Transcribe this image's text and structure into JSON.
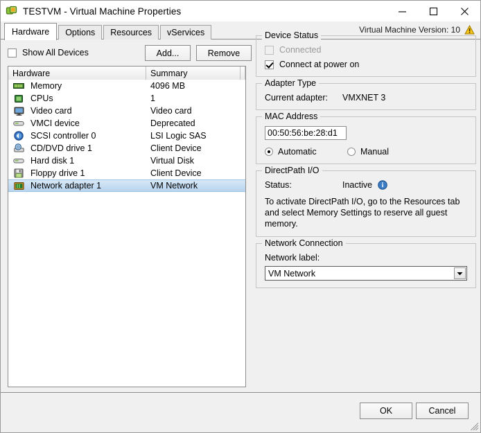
{
  "window": {
    "title": "TESTVM - Virtual Machine Properties",
    "app_icon": "vmware-vm-icon",
    "minimize_label": "Minimize",
    "maximize_label": "Maximize",
    "close_label": "Close"
  },
  "tabs": [
    {
      "label": "Hardware",
      "active": true
    },
    {
      "label": "Options",
      "active": false
    },
    {
      "label": "Resources",
      "active": false
    },
    {
      "label": "vServices",
      "active": false
    }
  ],
  "vm_version": {
    "text": "Virtual Machine Version:  10",
    "icon": "warning-triangle-icon"
  },
  "left_pane": {
    "show_all_devices": {
      "label": "Show All Devices",
      "checked": false
    },
    "add_button": "Add...",
    "remove_button": "Remove",
    "columns": [
      "Hardware",
      "Summary"
    ],
    "rows": [
      {
        "icon": "memory-icon",
        "name": "Memory",
        "summary": "4096 MB",
        "selected": false
      },
      {
        "icon": "cpu-icon",
        "name": "CPUs",
        "summary": "1",
        "selected": false
      },
      {
        "icon": "video-card-icon",
        "name": "Video card",
        "summary": "Video card",
        "selected": false
      },
      {
        "icon": "vmci-device-icon",
        "name": "VMCI device",
        "summary": "Deprecated",
        "selected": false
      },
      {
        "icon": "scsi-controller-icon",
        "name": "SCSI controller 0",
        "summary": "LSI Logic SAS",
        "selected": false
      },
      {
        "icon": "cd-dvd-drive-icon",
        "name": "CD/DVD drive 1",
        "summary": "Client Device",
        "selected": false
      },
      {
        "icon": "hard-disk-icon",
        "name": "Hard disk 1",
        "summary": "Virtual Disk",
        "selected": false
      },
      {
        "icon": "floppy-drive-icon",
        "name": "Floppy drive 1",
        "summary": "Client Device",
        "selected": false
      },
      {
        "icon": "network-adapter-icon",
        "name": "Network adapter 1",
        "summary": "VM Network",
        "selected": true
      }
    ]
  },
  "right_pane": {
    "device_status": {
      "legend": "Device Status",
      "connected": {
        "label": "Connected",
        "checked": false,
        "disabled": true
      },
      "connect_at_power_on": {
        "label": "Connect at power on",
        "checked": true,
        "disabled": false
      }
    },
    "adapter_type": {
      "legend": "Adapter Type",
      "current_adapter_label": "Current adapter:",
      "current_adapter_value": "VMXNET 3"
    },
    "mac_address": {
      "legend": "MAC Address",
      "value": "00:50:56:be:28:d1",
      "automatic_label": "Automatic",
      "manual_label": "Manual",
      "selected_mode": "Automatic"
    },
    "directpath": {
      "legend": "DirectPath I/O",
      "status_label": "Status:",
      "status_value": "Inactive",
      "info_icon": "info-icon",
      "note": "To activate DirectPath I/O, go to the Resources tab and select Memory Settings to reserve all guest memory."
    },
    "network_connection": {
      "legend": "Network Connection",
      "network_label_caption": "Network label:",
      "selected_network": "VM Network"
    }
  },
  "footer": {
    "ok_label": "OK",
    "cancel_label": "Cancel"
  },
  "colors": {
    "selection_top": "#d6e8f7",
    "selection_bottom": "#b9d4ee",
    "dialog_bg": "#f0f0f0",
    "info_blue": "#3b7cc4",
    "warning_yellow": "#f5c518"
  }
}
